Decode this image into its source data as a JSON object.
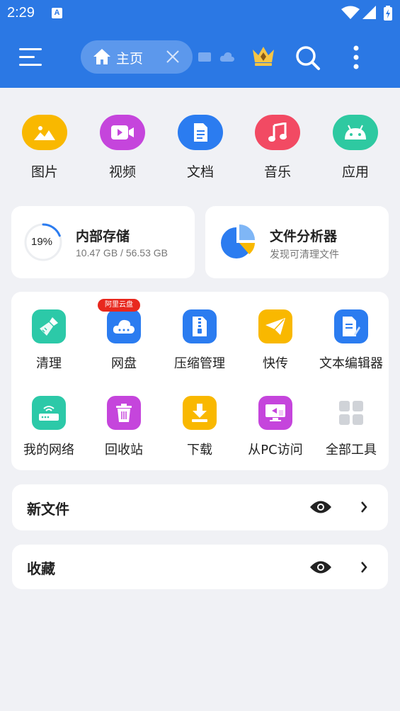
{
  "status_bar": {
    "time": "2:29",
    "notification_icon": "A"
  },
  "header": {
    "tab_label": "主页",
    "icons": [
      "menu-icon",
      "home-icon",
      "close-icon",
      "cast-icon",
      "cloud-icon",
      "crown-icon",
      "search-icon",
      "more-vert-icon"
    ]
  },
  "categories": [
    {
      "label": "图片",
      "icon": "image-icon",
      "color": "#f9b800"
    },
    {
      "label": "视频",
      "icon": "video-icon",
      "color": "#c545dc"
    },
    {
      "label": "文档",
      "icon": "document-icon",
      "color": "#2b7cf0"
    },
    {
      "label": "音乐",
      "icon": "music-icon",
      "color": "#f24a63"
    },
    {
      "label": "应用",
      "icon": "android-icon",
      "color": "#2ec9a1"
    }
  ],
  "storage": {
    "title": "内部存储",
    "percent_label": "19%",
    "percent": 19,
    "usage": "10.47 GB / 56.53 GB"
  },
  "analyzer": {
    "title": "文件分析器",
    "subtitle": "发现可清理文件"
  },
  "tools": [
    {
      "label": "清理",
      "icon": "broom-icon",
      "color": "#2cc9a8"
    },
    {
      "label": "网盘",
      "icon": "cloud-drive-icon",
      "color": "#2b7cf0",
      "badge": "阿里云盘"
    },
    {
      "label": "压缩管理",
      "icon": "zip-icon",
      "color": "#2b7cf0"
    },
    {
      "label": "快传",
      "icon": "send-icon",
      "color": "#f9b800"
    },
    {
      "label": "文本编辑器",
      "icon": "text-editor-icon",
      "color": "#2b7cf0"
    },
    {
      "label": "我的网络",
      "icon": "router-icon",
      "color": "#2cc9a8"
    },
    {
      "label": "回收站",
      "icon": "trash-icon",
      "color": "#c545dc"
    },
    {
      "label": "下载",
      "icon": "download-icon",
      "color": "#f9b800"
    },
    {
      "label": "从PC访问",
      "icon": "pc-access-icon",
      "color": "#c545dc"
    },
    {
      "label": "全部工具",
      "icon": "grid-icon",
      "color": "#d0d3d8"
    }
  ],
  "rows": [
    {
      "title": "新文件"
    },
    {
      "title": "收藏"
    }
  ]
}
